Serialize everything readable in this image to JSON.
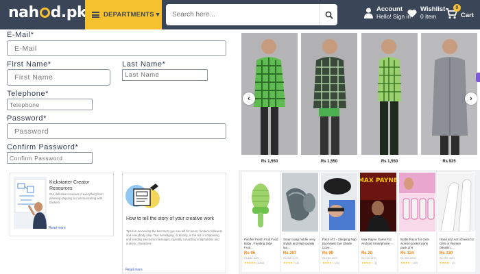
{
  "header": {
    "logo": {
      "pre": "nah",
      "post": "d.pk"
    },
    "departments_label": "DEPARTMENTS ▾",
    "search_placeholder": "Search here...",
    "account_title": "Account",
    "account_sub": "Hello! Sign in",
    "wishlist_title": "Wishlist",
    "wishlist_sub": "0 item",
    "cart_label": "Cart",
    "cart_count": "0"
  },
  "form": {
    "email_label": "E-Mail*",
    "email_placeholder": "E-Mail",
    "first_name_label": "First Name*",
    "first_name_placeholder": "First Name",
    "last_name_label": "Last Name*",
    "last_name_placeholder": "Last Name",
    "telephone_label": "Telephone*",
    "telephone_placeholder": "Telephone",
    "password_label": "Password*",
    "password_placeholder": "Password",
    "confirm_label": "Confirm Password*",
    "confirm_placeholder": "Confirm Password"
  },
  "blog": [
    {
      "title": "Kickstarter Creator Resources",
      "desc": "Our definitive rundown of everything from planning shipping to communicating with backers.",
      "more": "Read more"
    },
    {
      "title": "How to tell the story of your creative work",
      "desc": "Tips for uncovering the best story you can tell for press, funders, followers and everybody else. Text messaging, or texting, is the act of composing and sending electronic messages, typically consisting of alphabetic and numeric characters",
      "more": "Read more"
    }
  ],
  "carousel": {
    "prices": [
      "Rs 1,550",
      "Rs 1,550",
      "Rs 1,550",
      "Rs 925"
    ],
    "colors": {
      "shirt_green_check": "#5dbb4f",
      "shirt_dark_check": "#3a4a3a",
      "shirt_light_check": "#9bd06f",
      "shirt_grey": "#8c8f96"
    }
  },
  "products": [
    {
      "name": "Pacifier Fresh Fruit Food Baby , Feeding Side Fruit...",
      "price": "Rs 95",
      "old": "Rs 180 -48%",
      "stars": "★★★★★",
      "count": "(1004)"
    },
    {
      "name": "Smart soap holder very stylish and high quality lea...",
      "price": "Rs 207",
      "old": "Rs 349 -41%",
      "stars": "★★★★☆",
      "count": "(4)"
    },
    {
      "name": "Pack of 2 - Sleeping Nap Eye Mask Eye Shade Cove...",
      "price": "Rs 99",
      "old": "Rs 180 -45%",
      "stars": "★★★★☆",
      "count": "(24)"
    },
    {
      "name": "Max Payne Game For Android Smartphone -...",
      "price": "Rs 20",
      "old": "Rs 100 -80%",
      "stars": "★★★★☆",
      "count": "(7)"
    },
    {
      "name": "Bottle Razor for Girls women pocket parts pack of 6",
      "price": "Rs 124",
      "old": "Rs 400 -69%",
      "stars": "★★★★☆",
      "count": "(30)"
    },
    {
      "name": "Hand and Arm Gloves for Girls or Women (Muslim...",
      "price": "Rs 130",
      "old": "Rs 250 -48%",
      "stars": "★★★★☆",
      "count": "(2)"
    }
  ],
  "game_title": "MAX PAYNE",
  "blog_image_label": "Kickstarter"
}
